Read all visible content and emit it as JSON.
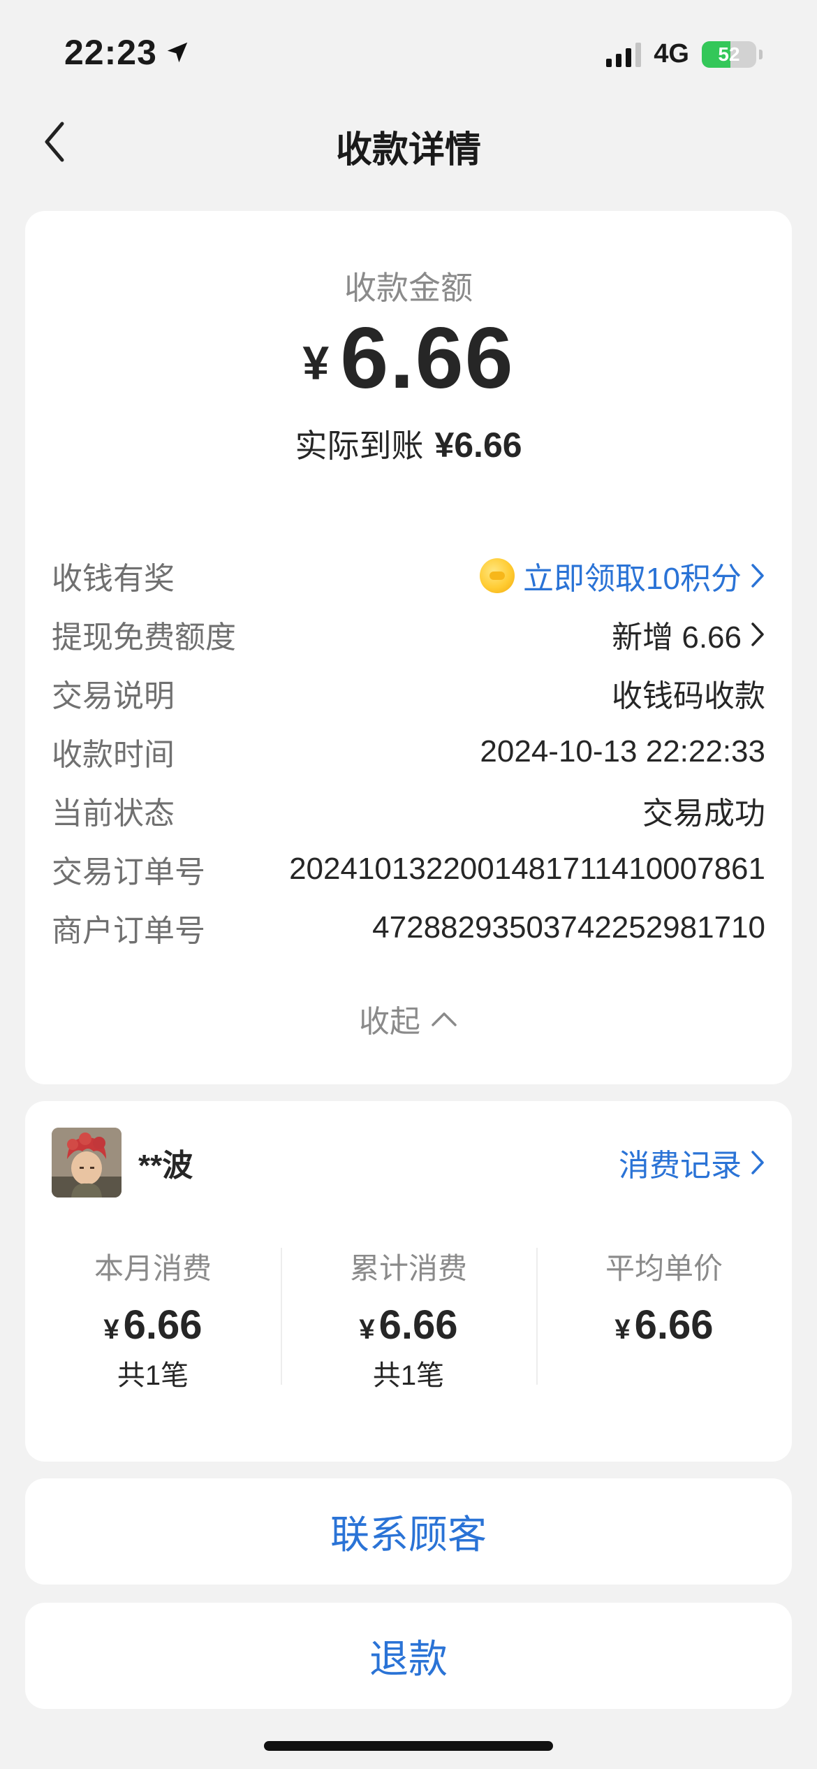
{
  "status_bar": {
    "time": "22:23",
    "network": "4G",
    "battery": "52",
    "battery_level": 0.52
  },
  "nav": {
    "title": "收款详情"
  },
  "amount": {
    "label": "收款金额",
    "currency": "¥",
    "value": "6.66",
    "settled_label": "实际到账",
    "settled_value": "¥6.66"
  },
  "details": [
    {
      "label": "收钱有奖",
      "value": "立即领取10积分",
      "link": true,
      "icon": "coin-icon",
      "chevron": true
    },
    {
      "label": "提现免费额度",
      "value": "新增 6.66",
      "link": false,
      "chevron": true
    },
    {
      "label": "交易说明",
      "value": "收钱码收款"
    },
    {
      "label": "收款时间",
      "value": "2024-10-13 22:22:33"
    },
    {
      "label": "当前状态",
      "value": "交易成功"
    },
    {
      "label": "交易订单号",
      "value": "20241013220014817114100078​61"
    },
    {
      "label": "商户订单号",
      "value": "472882935037422529817​10"
    }
  ],
  "collapse_label": "收起",
  "customer": {
    "name": "**波",
    "record_label": "消费记录",
    "stats": [
      {
        "label": "本月消费",
        "currency": "¥",
        "value": "6.66",
        "count": "共1笔"
      },
      {
        "label": "累计消费",
        "currency": "¥",
        "value": "6.66",
        "count": "共1笔"
      },
      {
        "label": "平均单价",
        "currency": "¥",
        "value": "6.66",
        "count": ""
      }
    ]
  },
  "actions": {
    "contact": "联系顾客",
    "refund": "退款"
  },
  "colors": {
    "accent": "#2a73d6",
    "background": "#f2f2f2",
    "battery": "#34c759"
  }
}
